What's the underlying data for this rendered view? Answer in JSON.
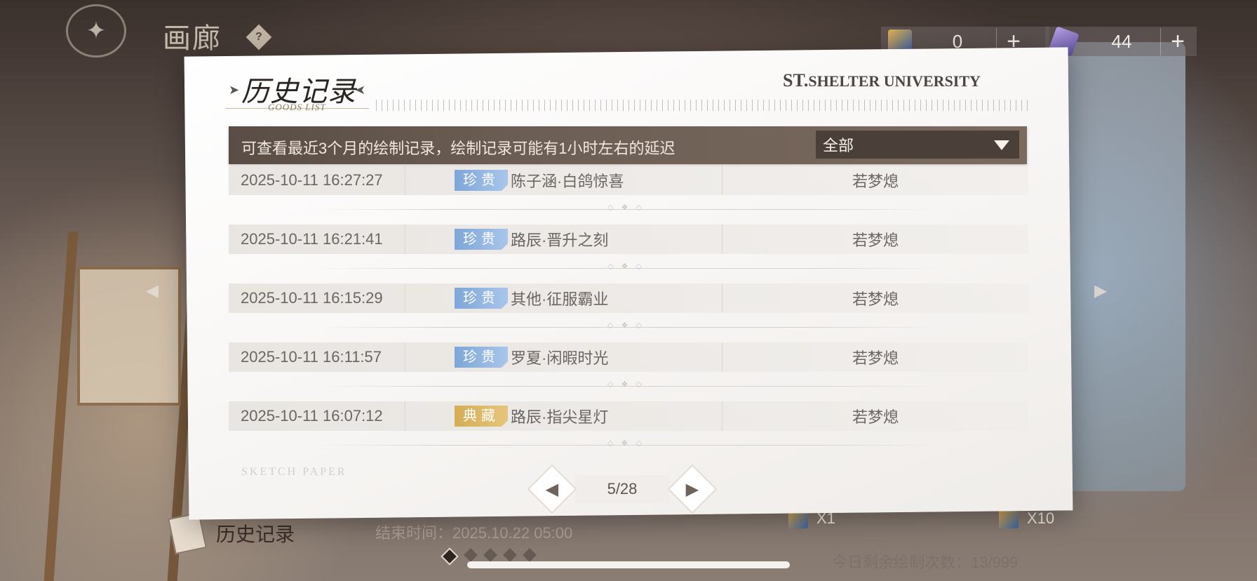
{
  "topbar": {
    "title": "画廊",
    "help_glyph": "?",
    "currencies": [
      {
        "icon": "draw-ticket-icon",
        "value": "0",
        "plus": "+"
      },
      {
        "icon": "diamond-icon",
        "value": "44",
        "plus": "+"
      }
    ]
  },
  "modal": {
    "title": "历史记录",
    "subtitle": "GOODS LIST",
    "brand_st": "ST.",
    "brand_rest": "SHELTER UNIVERSITY",
    "info": "可查看最近3个月的绘制记录，绘制记录可能有1小时左右的延迟",
    "filter_value": "全部",
    "records": [
      {
        "time": "2025-10-11  16:27:27",
        "tag": "珍贵",
        "tag_type": "rare",
        "item": "陈子涵·白鸽惊喜",
        "owner": "若梦熄"
      },
      {
        "time": "2025-10-11  16:21:41",
        "tag": "珍贵",
        "tag_type": "rare",
        "item": "路辰·晋升之刻",
        "owner": "若梦熄"
      },
      {
        "time": "2025-10-11  16:15:29",
        "tag": "珍贵",
        "tag_type": "rare",
        "item": "其他·征服霸业",
        "owner": "若梦熄"
      },
      {
        "time": "2025-10-11  16:11:57",
        "tag": "珍贵",
        "tag_type": "rare",
        "item": "罗夏·闲暇时光",
        "owner": "若梦熄"
      },
      {
        "time": "2025-10-11  16:07:12",
        "tag": "典藏",
        "tag_type": "collect",
        "item": "路辰·指尖星灯",
        "owner": "若梦熄"
      }
    ],
    "watermark": "SKETCH PAPER",
    "pager": {
      "prev": "◀",
      "next": "▶",
      "text": "5/28"
    }
  },
  "bottom": {
    "history_label": "历史记录",
    "end_time": "结束时间：2025.10.22  05:00",
    "draw_one": "X1",
    "draw_ten": "X10",
    "remaining": "今日剩余绘制次数：13/999"
  },
  "colors": {
    "rare_tag": "#7ea6d8",
    "collect_tag": "#d4ad55",
    "info_bar": "#5a4d45"
  }
}
